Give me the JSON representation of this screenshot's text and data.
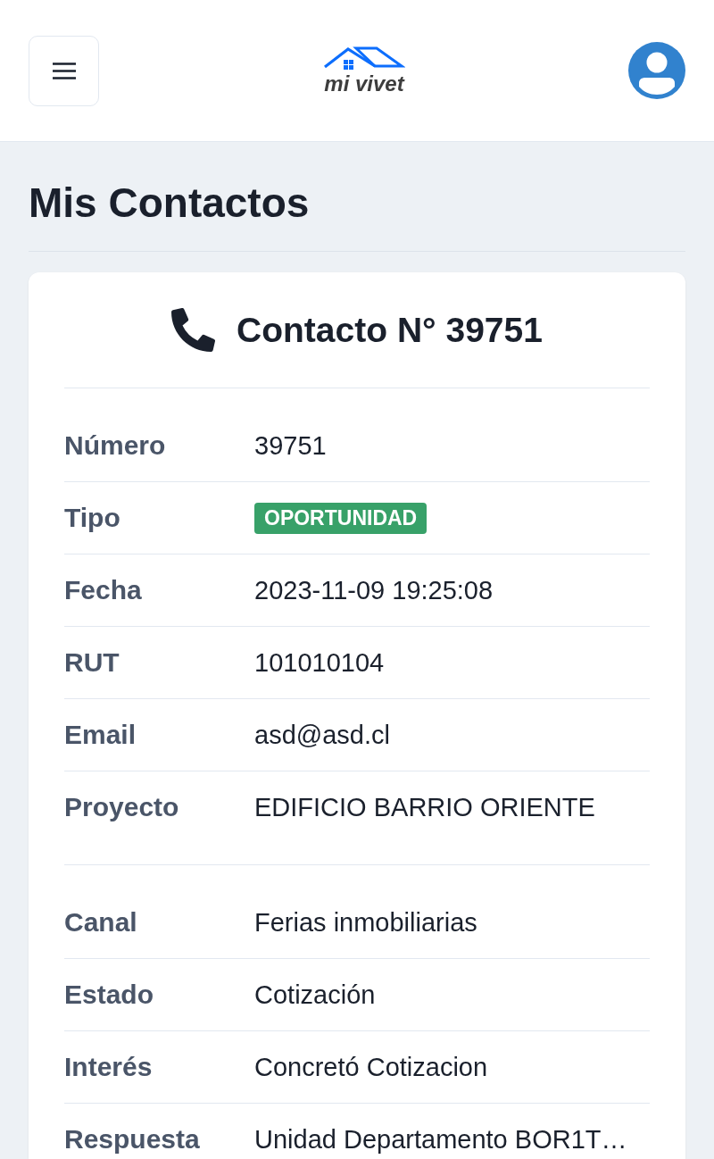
{
  "header": {
    "logo_text": "mi vivet"
  },
  "page": {
    "title": "Mis Contactos"
  },
  "card": {
    "title": "Contacto N° 39751",
    "sections": [
      {
        "rows": [
          {
            "kind": "text",
            "label": "Número",
            "value": "39751"
          },
          {
            "kind": "badge",
            "label": "Tipo",
            "value": "OPORTUNIDAD"
          },
          {
            "kind": "text",
            "label": "Fecha",
            "value": "2023-11-09 19:25:08"
          },
          {
            "kind": "text",
            "label": "RUT",
            "value": "101010104"
          },
          {
            "kind": "text",
            "label": "Email",
            "value": "asd@asd.cl"
          },
          {
            "kind": "text",
            "label": "Proyecto",
            "value": "EDIFICIO BARRIO ORIENTE"
          }
        ]
      },
      {
        "rows": [
          {
            "kind": "text",
            "label": "Canal",
            "value": "Ferias inmobiliarias"
          },
          {
            "kind": "text",
            "label": "Estado",
            "value": "Cotización"
          },
          {
            "kind": "text",
            "label": "Interés",
            "value": "Concretó Cotizacion"
          },
          {
            "kind": "text",
            "label": "Respuesta",
            "value": "Unidad Departamento BOR1T…"
          }
        ]
      }
    ]
  }
}
